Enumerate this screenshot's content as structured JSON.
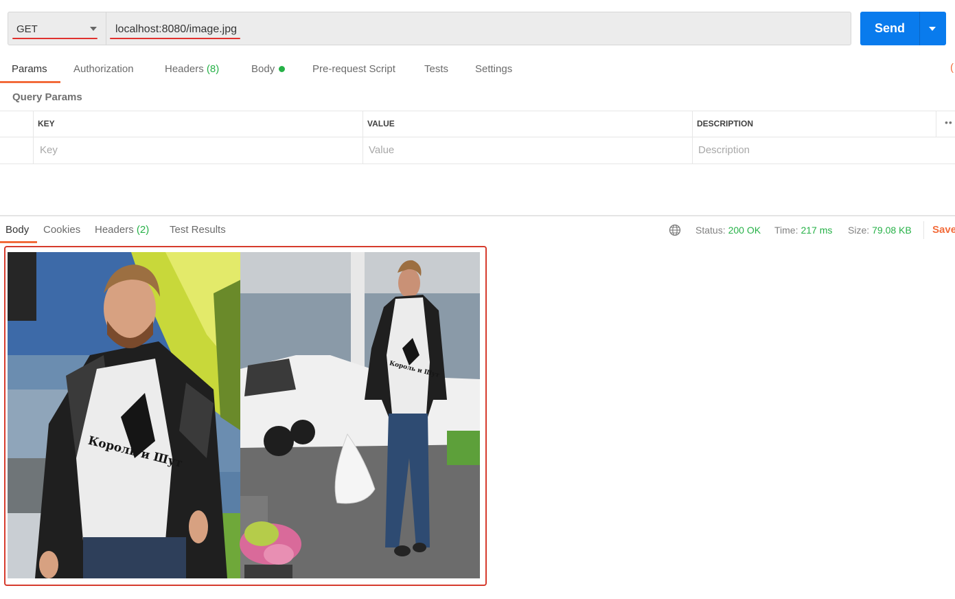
{
  "request": {
    "method": "GET",
    "url": "localhost:8080/image.jpg",
    "send_label": "Send"
  },
  "request_tabs": [
    {
      "label": "Params"
    },
    {
      "label": "Authorization"
    },
    {
      "label": "Headers",
      "count": "(8)"
    },
    {
      "label": "Body"
    },
    {
      "label": "Pre-request Script"
    },
    {
      "label": "Tests"
    },
    {
      "label": "Settings"
    }
  ],
  "query_params": {
    "title": "Query Params",
    "columns": [
      "KEY",
      "VALUE",
      "DESCRIPTION"
    ],
    "placeholders": [
      "Key",
      "Value",
      "Description"
    ]
  },
  "response_tabs": [
    {
      "label": "Body"
    },
    {
      "label": "Cookies"
    },
    {
      "label": "Headers",
      "count": "(2)"
    },
    {
      "label": "Test Results"
    }
  ],
  "response_meta": {
    "status_label": "Status:",
    "status_value": "200 OK",
    "time_label": "Time:",
    "time_value": "217 ms",
    "size_label": "Size:",
    "size_value": "79.08 KB",
    "save_label": "Save"
  },
  "photo_text": {
    "left_shirt": "Король и Шут",
    "right_shirt": "Король и Шут"
  },
  "colors": {
    "accent": "#f26b3a",
    "send": "#097bed",
    "success": "#26b147",
    "highlight": "#d63a2c"
  }
}
